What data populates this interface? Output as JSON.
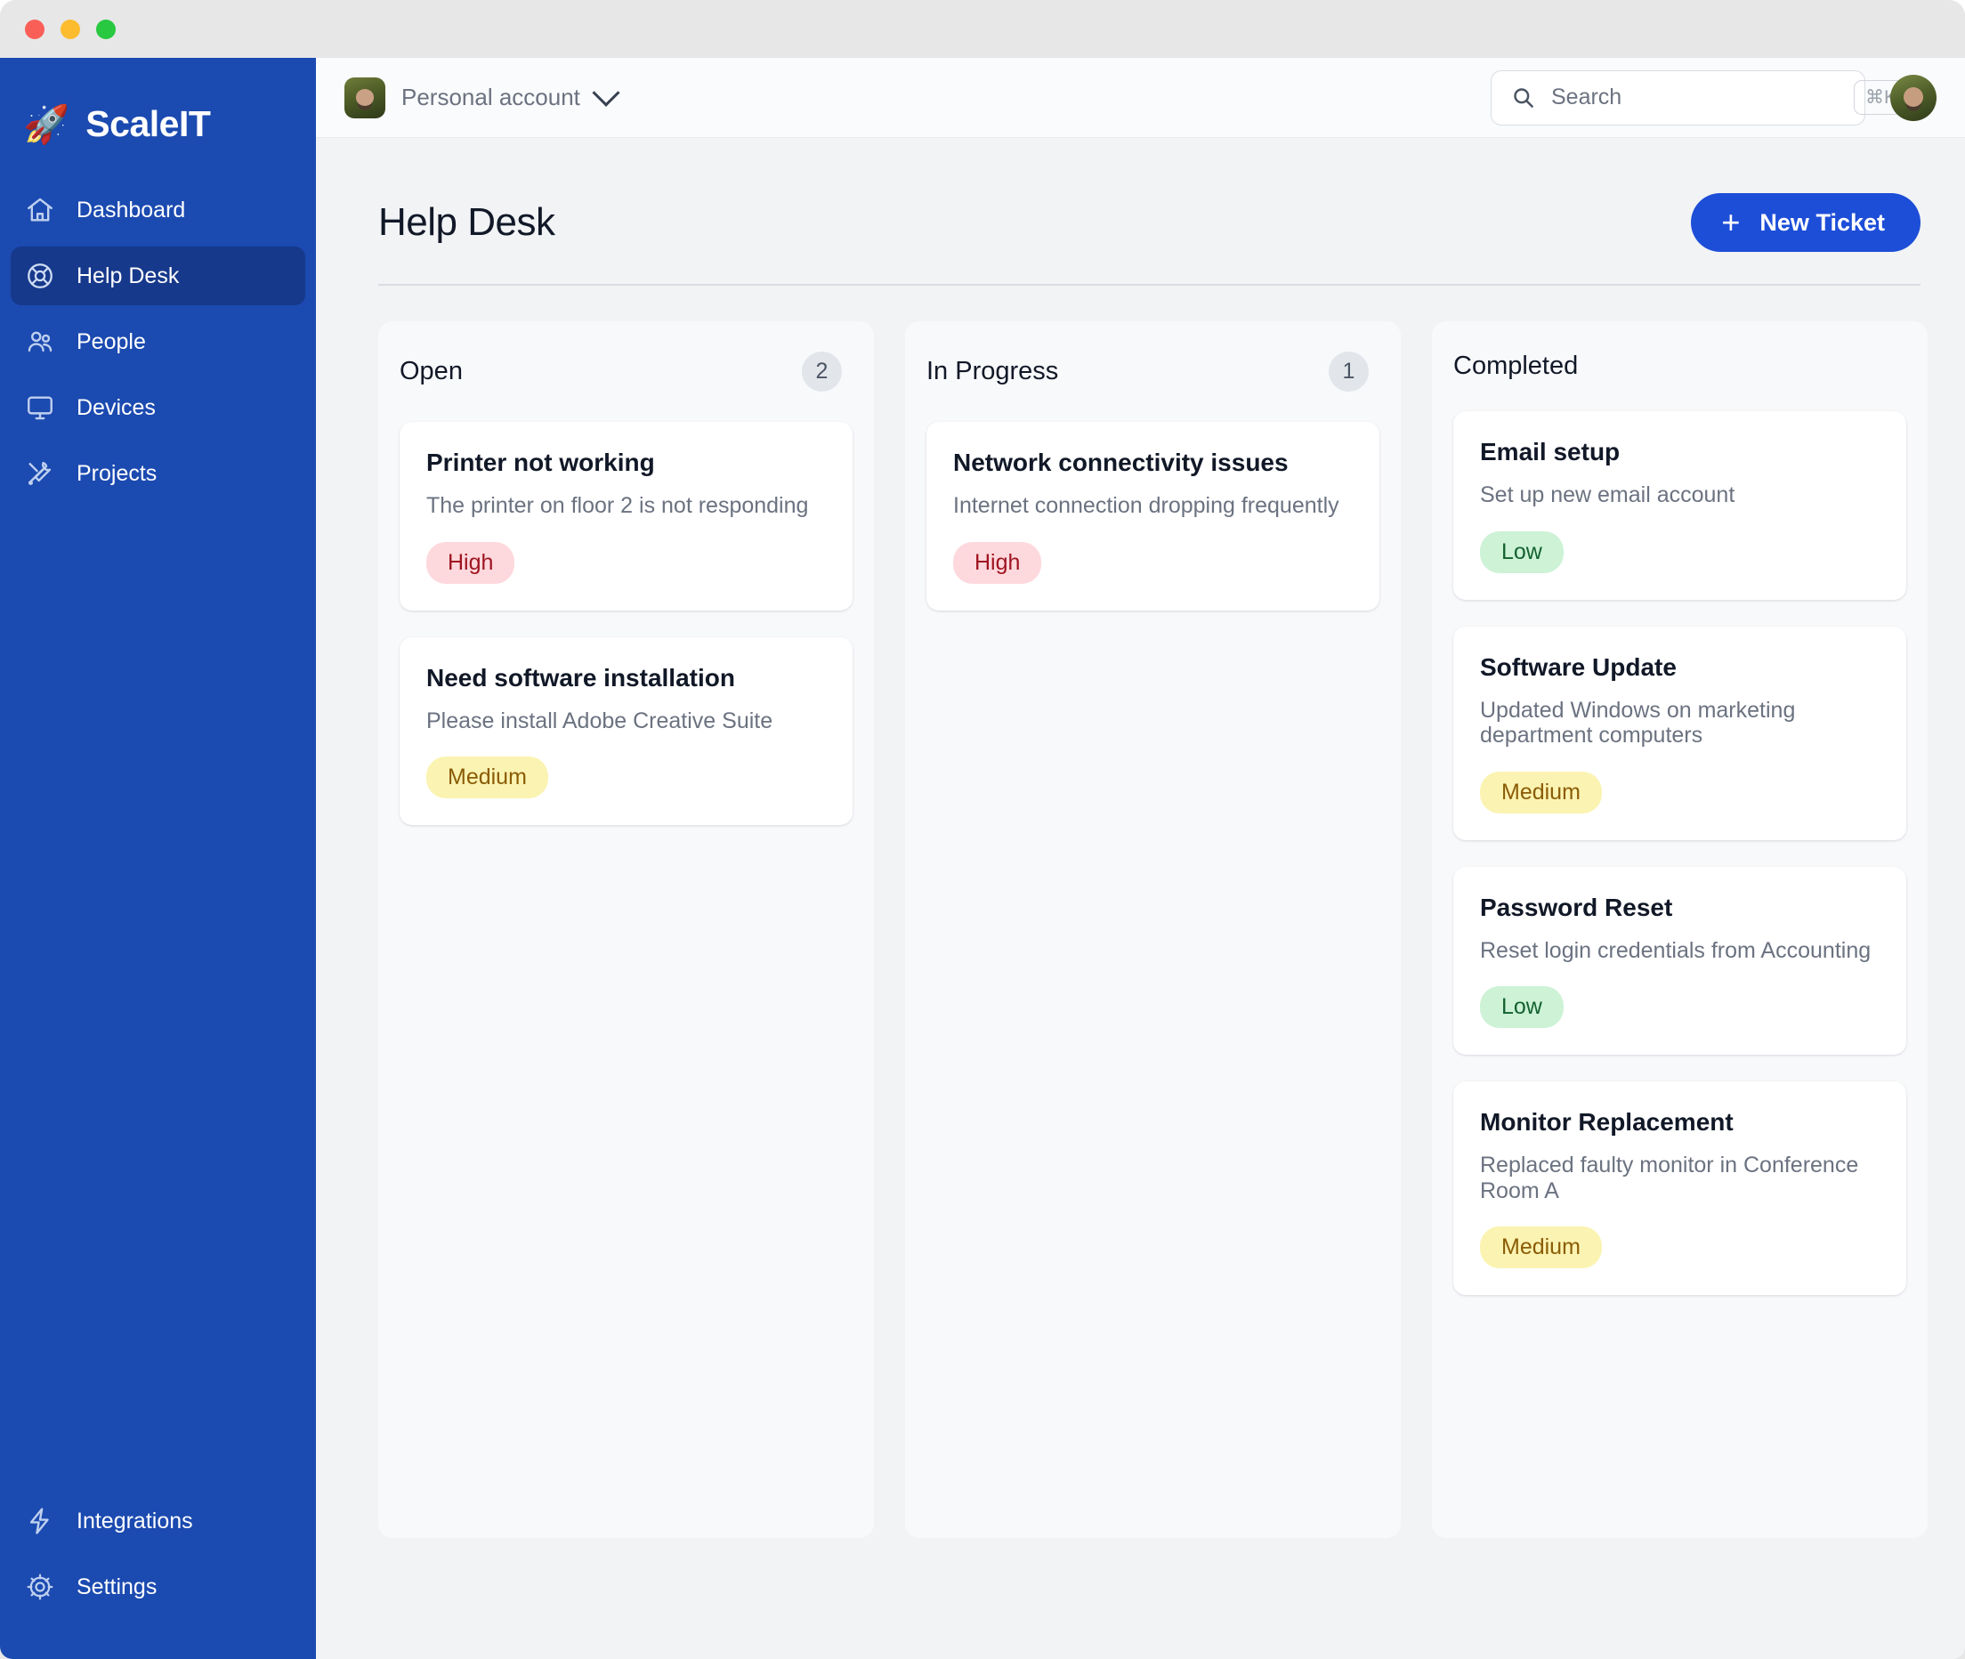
{
  "titlebar": {
    "controls": [
      "close",
      "minimize",
      "maximize"
    ]
  },
  "sidebar": {
    "brand": {
      "icon": "rocket",
      "name": "ScaleIT"
    },
    "items": [
      {
        "label": "Dashboard",
        "icon": "home-icon",
        "active": false
      },
      {
        "label": "Help Desk",
        "icon": "lifebuoy-icon",
        "active": true
      },
      {
        "label": "People",
        "icon": "people-icon",
        "active": false
      },
      {
        "label": "Devices",
        "icon": "monitor-icon",
        "active": false
      },
      {
        "label": "Projects",
        "icon": "tools-icon",
        "active": false
      }
    ],
    "bottom_items": [
      {
        "label": "Integrations",
        "icon": "bolt-icon"
      },
      {
        "label": "Settings",
        "icon": "gear-icon"
      }
    ]
  },
  "topbar": {
    "account_label": "Personal account",
    "account_chevron": "chevron-down-icon",
    "search": {
      "placeholder": "Search",
      "value": "",
      "shortcut": "⌘K",
      "icon": "search-icon"
    },
    "user_avatar": "avatar"
  },
  "page": {
    "title": "Help Desk",
    "new_ticket_label": "New Ticket",
    "new_ticket_icon": "plus-icon"
  },
  "board": {
    "columns": [
      {
        "title": "Open",
        "count": "2",
        "cards": [
          {
            "title": "Printer not working",
            "desc": "The printer on floor 2 is not responding",
            "priority": "High",
            "priority_class": "high"
          },
          {
            "title": "Need software installation",
            "desc": "Please install Adobe Creative Suite",
            "priority": "Medium",
            "priority_class": "medium"
          }
        ]
      },
      {
        "title": "In Progress",
        "count": "1",
        "cards": [
          {
            "title": "Network connectivity issues",
            "desc": "Internet connection dropping frequently",
            "priority": "High",
            "priority_class": "high"
          }
        ]
      },
      {
        "title": "Completed",
        "count": "",
        "cards": [
          {
            "title": "Email setup",
            "desc": "Set up new email account",
            "priority": "Low",
            "priority_class": "low"
          },
          {
            "title": "Software Update",
            "desc": "Updated Windows on marketing department computers",
            "priority": "Medium",
            "priority_class": "medium"
          },
          {
            "title": "Password Reset",
            "desc": "Reset login credentials from Accounting",
            "priority": "Low",
            "priority_class": "low"
          },
          {
            "title": "Monitor Replacement",
            "desc": "Replaced faulty monitor in Conference Room A",
            "priority": "Medium",
            "priority_class": "medium"
          }
        ]
      }
    ]
  },
  "colors": {
    "brand_blue": "#1b4ab0",
    "accent_blue": "#1d4ed8",
    "active_nav": "#17398c",
    "canvas": "#f1f3f5",
    "column_bg": "#f8f9fb"
  }
}
